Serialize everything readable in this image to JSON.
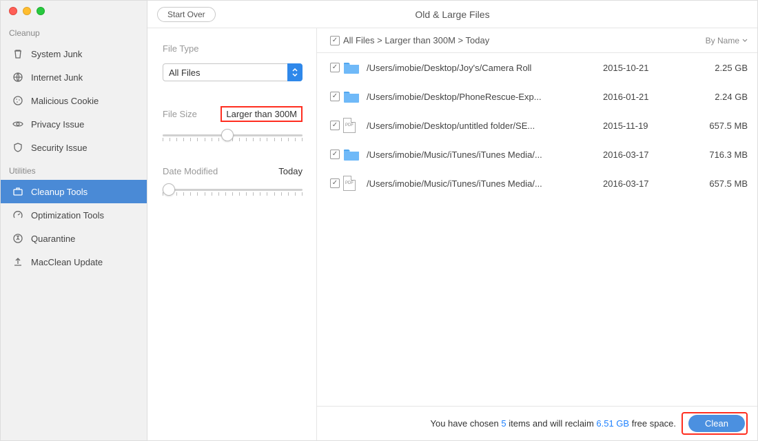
{
  "window": {
    "title": "Old & Large Files",
    "start_over": "Start Over"
  },
  "sidebar": {
    "groups": [
      {
        "label": "Cleanup",
        "items": [
          {
            "slug": "system-junk",
            "icon": "trash-icon",
            "label": "System Junk",
            "selected": false
          },
          {
            "slug": "internet-junk",
            "icon": "globe-icon",
            "label": "Internet Junk",
            "selected": false
          },
          {
            "slug": "malicious-cookie",
            "icon": "cookie-icon",
            "label": "Malicious Cookie",
            "selected": false
          },
          {
            "slug": "privacy-issue",
            "icon": "eye-icon",
            "label": "Privacy Issue",
            "selected": false
          },
          {
            "slug": "security-issue",
            "icon": "shield-icon",
            "label": "Security Issue",
            "selected": false
          }
        ]
      },
      {
        "label": "Utilities",
        "items": [
          {
            "slug": "cleanup-tools",
            "icon": "briefcase-icon",
            "label": "Cleanup Tools",
            "selected": true
          },
          {
            "slug": "optimization-tools",
            "icon": "gauge-icon",
            "label": "Optimization Tools",
            "selected": false
          },
          {
            "slug": "quarantine",
            "icon": "quarantine-icon",
            "label": "Quarantine",
            "selected": false
          },
          {
            "slug": "macclean-update",
            "icon": "upload-icon",
            "label": "MacClean Update",
            "selected": false
          }
        ]
      }
    ]
  },
  "filters": {
    "file_type": {
      "label": "File Type",
      "value": "All Files"
    },
    "file_size": {
      "label": "File Size",
      "value": "Larger than 300M"
    },
    "date_modified": {
      "label": "Date Modified",
      "value": "Today"
    }
  },
  "list": {
    "breadcrumb": "All Files > Larger than 300M > Today",
    "sort_label": "By Name",
    "header_checked": true,
    "rows": [
      {
        "checked": true,
        "icon": "folder",
        "path": "/Users/imobie/Desktop/Joy's/Camera Roll",
        "date": "2015-10-21",
        "size": "2.25 GB"
      },
      {
        "checked": true,
        "icon": "folder",
        "path": "/Users/imobie/Desktop/PhoneRescue-Exp...",
        "date": "2016-01-21",
        "size": "2.24 GB"
      },
      {
        "checked": true,
        "icon": "pdf",
        "path": "/Users/imobie/Desktop/untitled folder/SE...",
        "date": "2015-11-19",
        "size": "657.5 MB"
      },
      {
        "checked": true,
        "icon": "folder",
        "path": "/Users/imobie/Music/iTunes/iTunes Media/...",
        "date": "2016-03-17",
        "size": "716.3 MB"
      },
      {
        "checked": true,
        "icon": "pdf",
        "path": "/Users/imobie/Music/iTunes/iTunes Media/...",
        "date": "2016-03-17",
        "size": "657.5 MB"
      }
    ]
  },
  "footer": {
    "pre": "You have chosen ",
    "count": "5",
    "mid": " items and will reclaim ",
    "reclaim": "6.51 GB",
    "post": " free space.",
    "clean": "Clean"
  }
}
